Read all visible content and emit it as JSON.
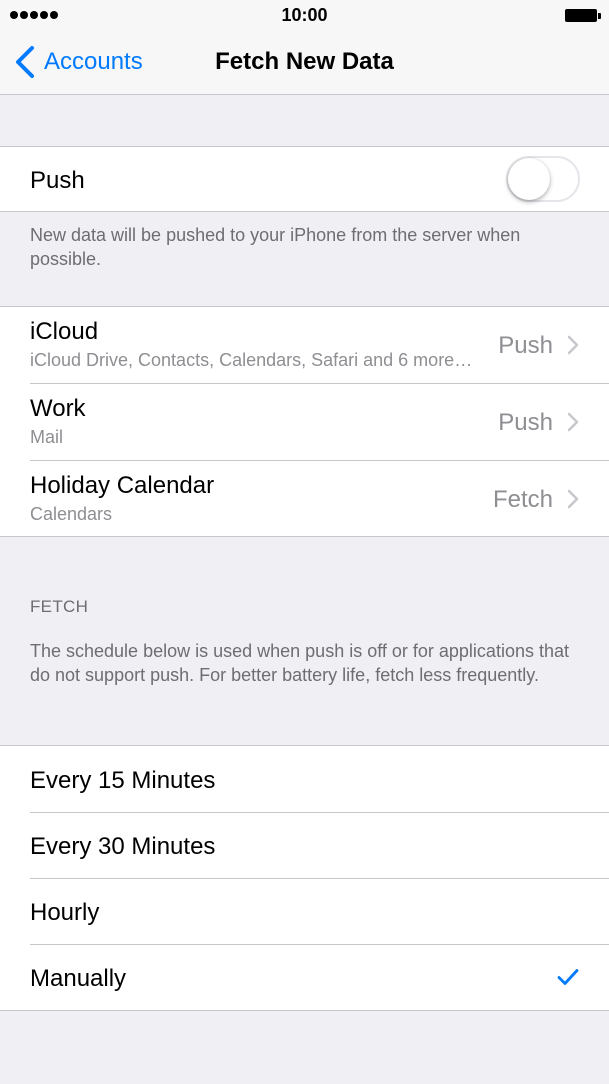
{
  "status_bar": {
    "time": "10:00"
  },
  "nav": {
    "back_label": "Accounts",
    "title": "Fetch New Data"
  },
  "push": {
    "label": "Push",
    "enabled": false,
    "footnote": "New data will be pushed to your iPhone from the server when possible."
  },
  "accounts": [
    {
      "name": "iCloud",
      "services": "iCloud Drive, Contacts, Calendars, Safari and 6 more…",
      "mode": "Push"
    },
    {
      "name": "Work",
      "services": "Mail",
      "mode": "Push"
    },
    {
      "name": "Holiday Calendar",
      "services": "Calendars",
      "mode": "Fetch"
    }
  ],
  "fetch": {
    "header": "FETCH",
    "description": "The schedule below is used when push is off or for applications that do not support push. For better battery life, fetch less frequently.",
    "options": [
      {
        "label": "Every 15 Minutes",
        "selected": false
      },
      {
        "label": "Every 30 Minutes",
        "selected": false
      },
      {
        "label": "Hourly",
        "selected": false
      },
      {
        "label": "Manually",
        "selected": true
      }
    ]
  },
  "colors": {
    "accent": "#007aff",
    "background": "#efeff4",
    "secondary_text": "#8e8e93",
    "separator": "#c8c7cc"
  }
}
